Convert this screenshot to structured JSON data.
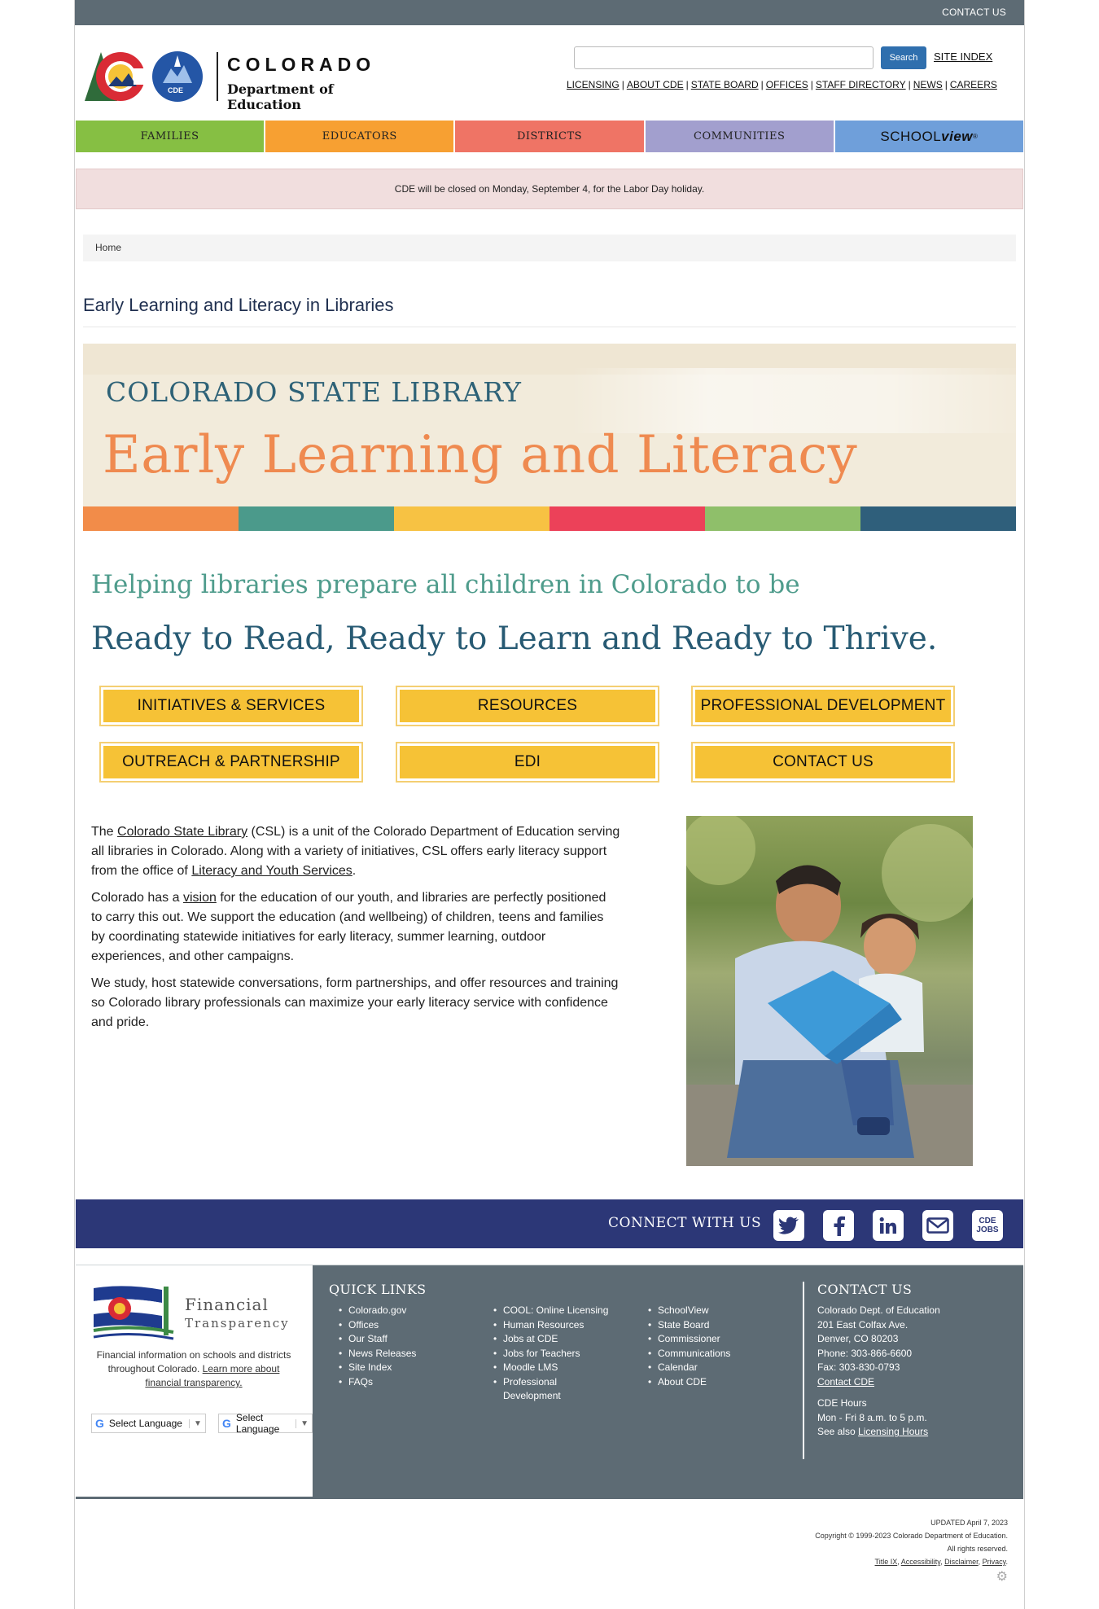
{
  "topbar": {
    "contact_label": "CONTACT US"
  },
  "header": {
    "org_name_line1": "COLORADO",
    "org_name_line2": "Department of Education",
    "logo_badge": "CDE",
    "search_placeholder": "",
    "search_button": "Search",
    "site_index": "SITE INDEX",
    "util_links": [
      "LICENSING",
      "ABOUT CDE",
      "STATE BOARD",
      "OFFICES",
      "STAFF DIRECTORY",
      "NEWS",
      "CAREERS"
    ]
  },
  "mainnav": {
    "items": [
      "FAMILIES",
      "EDUCATORS",
      "DISTRICTS",
      "COMMUNITIES"
    ],
    "schoolview_prefix": "SCHOOL",
    "schoolview_suffix": "view",
    "schoolview_mark": "®"
  },
  "alert": {
    "text": "CDE will be closed on Monday, September 4, for the Labor Day holiday."
  },
  "breadcrumb": {
    "home": "Home"
  },
  "page_title": "Early Learning and Literacy in Libraries",
  "banner": {
    "kicker": "COLORADO STATE LIBRARY",
    "headline": "Early Learning and Literacy",
    "stripe_colors": [
      "#f28c49",
      "#4b9a8b",
      "#f7c243",
      "#ec4159",
      "#8fbf6a",
      "#2f5f7b"
    ]
  },
  "tagline": {
    "line1": "Helping libraries prepare all children in Colorado to be",
    "line2": "Ready to Read, Ready to Learn and Ready to Thrive."
  },
  "buttons": [
    "INITIATIVES & SERVICES",
    "RESOURCES",
    "PROFESSIONAL DEVELOPMENT",
    "OUTREACH & PARTNERSHIP",
    "EDI",
    "CONTACT US"
  ],
  "copy": {
    "p1_a": "The ",
    "p1_link1": "Colorado State Library",
    "p1_b": " (CSL) is a unit of the Colorado Department of Education serving all libraries in Colorado. Along with a variety of initiatives, CSL offers early literacy support from the office of ",
    "p1_link2": "Literacy and Youth Services",
    "p1_c": ".",
    "p2_a": "Colorado has a ",
    "p2_link": "vision",
    "p2_b": " for the education of our youth, and libraries are perfectly positioned to carry this out. We support the education (and wellbeing) of children, teens and families by coordinating statewide initiatives for early literacy, summer learning, outdoor experiences, and other campaigns.",
    "p3": "We study, host statewide conversations, form partnerships, and offer resources and training so Colorado library professionals can maximize your early literacy service with confidence and pride."
  },
  "connect": {
    "label": "CONNECT WITH US",
    "icons": [
      "twitter-icon",
      "facebook-icon",
      "linkedin-icon",
      "email-icon",
      "cde-jobs-icon"
    ],
    "jobs_label_1": "CDE",
    "jobs_label_2": "JOBS"
  },
  "footer": {
    "ft_title1": "Financial",
    "ft_title2": "Transparency",
    "ft_desc": "Financial information on schools and districts throughout Colorado. ",
    "ft_link": "Learn more about financial transparency.",
    "lang_label": "Select Language",
    "quick_links_heading": "QUICK LINKS",
    "col1": [
      "Colorado.gov",
      "Offices",
      "Our Staff",
      "News Releases",
      "Site Index",
      "FAQs"
    ],
    "col2": [
      "COOL: Online Licensing",
      "Human Resources",
      "Jobs at CDE",
      "Jobs for Teachers",
      "Moodle LMS",
      "Professional Development"
    ],
    "col3": [
      "SchoolView",
      "State Board",
      "Commissioner",
      "Communications",
      "Calendar",
      "About CDE"
    ],
    "contact_heading": "CONTACT US",
    "contact_lines": [
      "Colorado Dept. of Education",
      "201 East Colfax Ave.",
      "Denver, CO 80203",
      "Phone: 303-866-6600",
      "Fax: 303-830-0793"
    ],
    "contact_link": "Contact CDE",
    "hours_heading": "CDE Hours",
    "hours_line": "Mon - Fri 8 a.m. to 5 p.m.",
    "see_also": "See also ",
    "licensing_hours": "Licensing Hours"
  },
  "legal": {
    "updated": "UPDATED April 7, 2023",
    "copyright": "Copyright © 1999-2023 Colorado Department of Education.",
    "rights": "All rights reserved.",
    "links": [
      "Title IX",
      "Accessibility",
      "Disclaimer",
      "Privacy"
    ]
  }
}
